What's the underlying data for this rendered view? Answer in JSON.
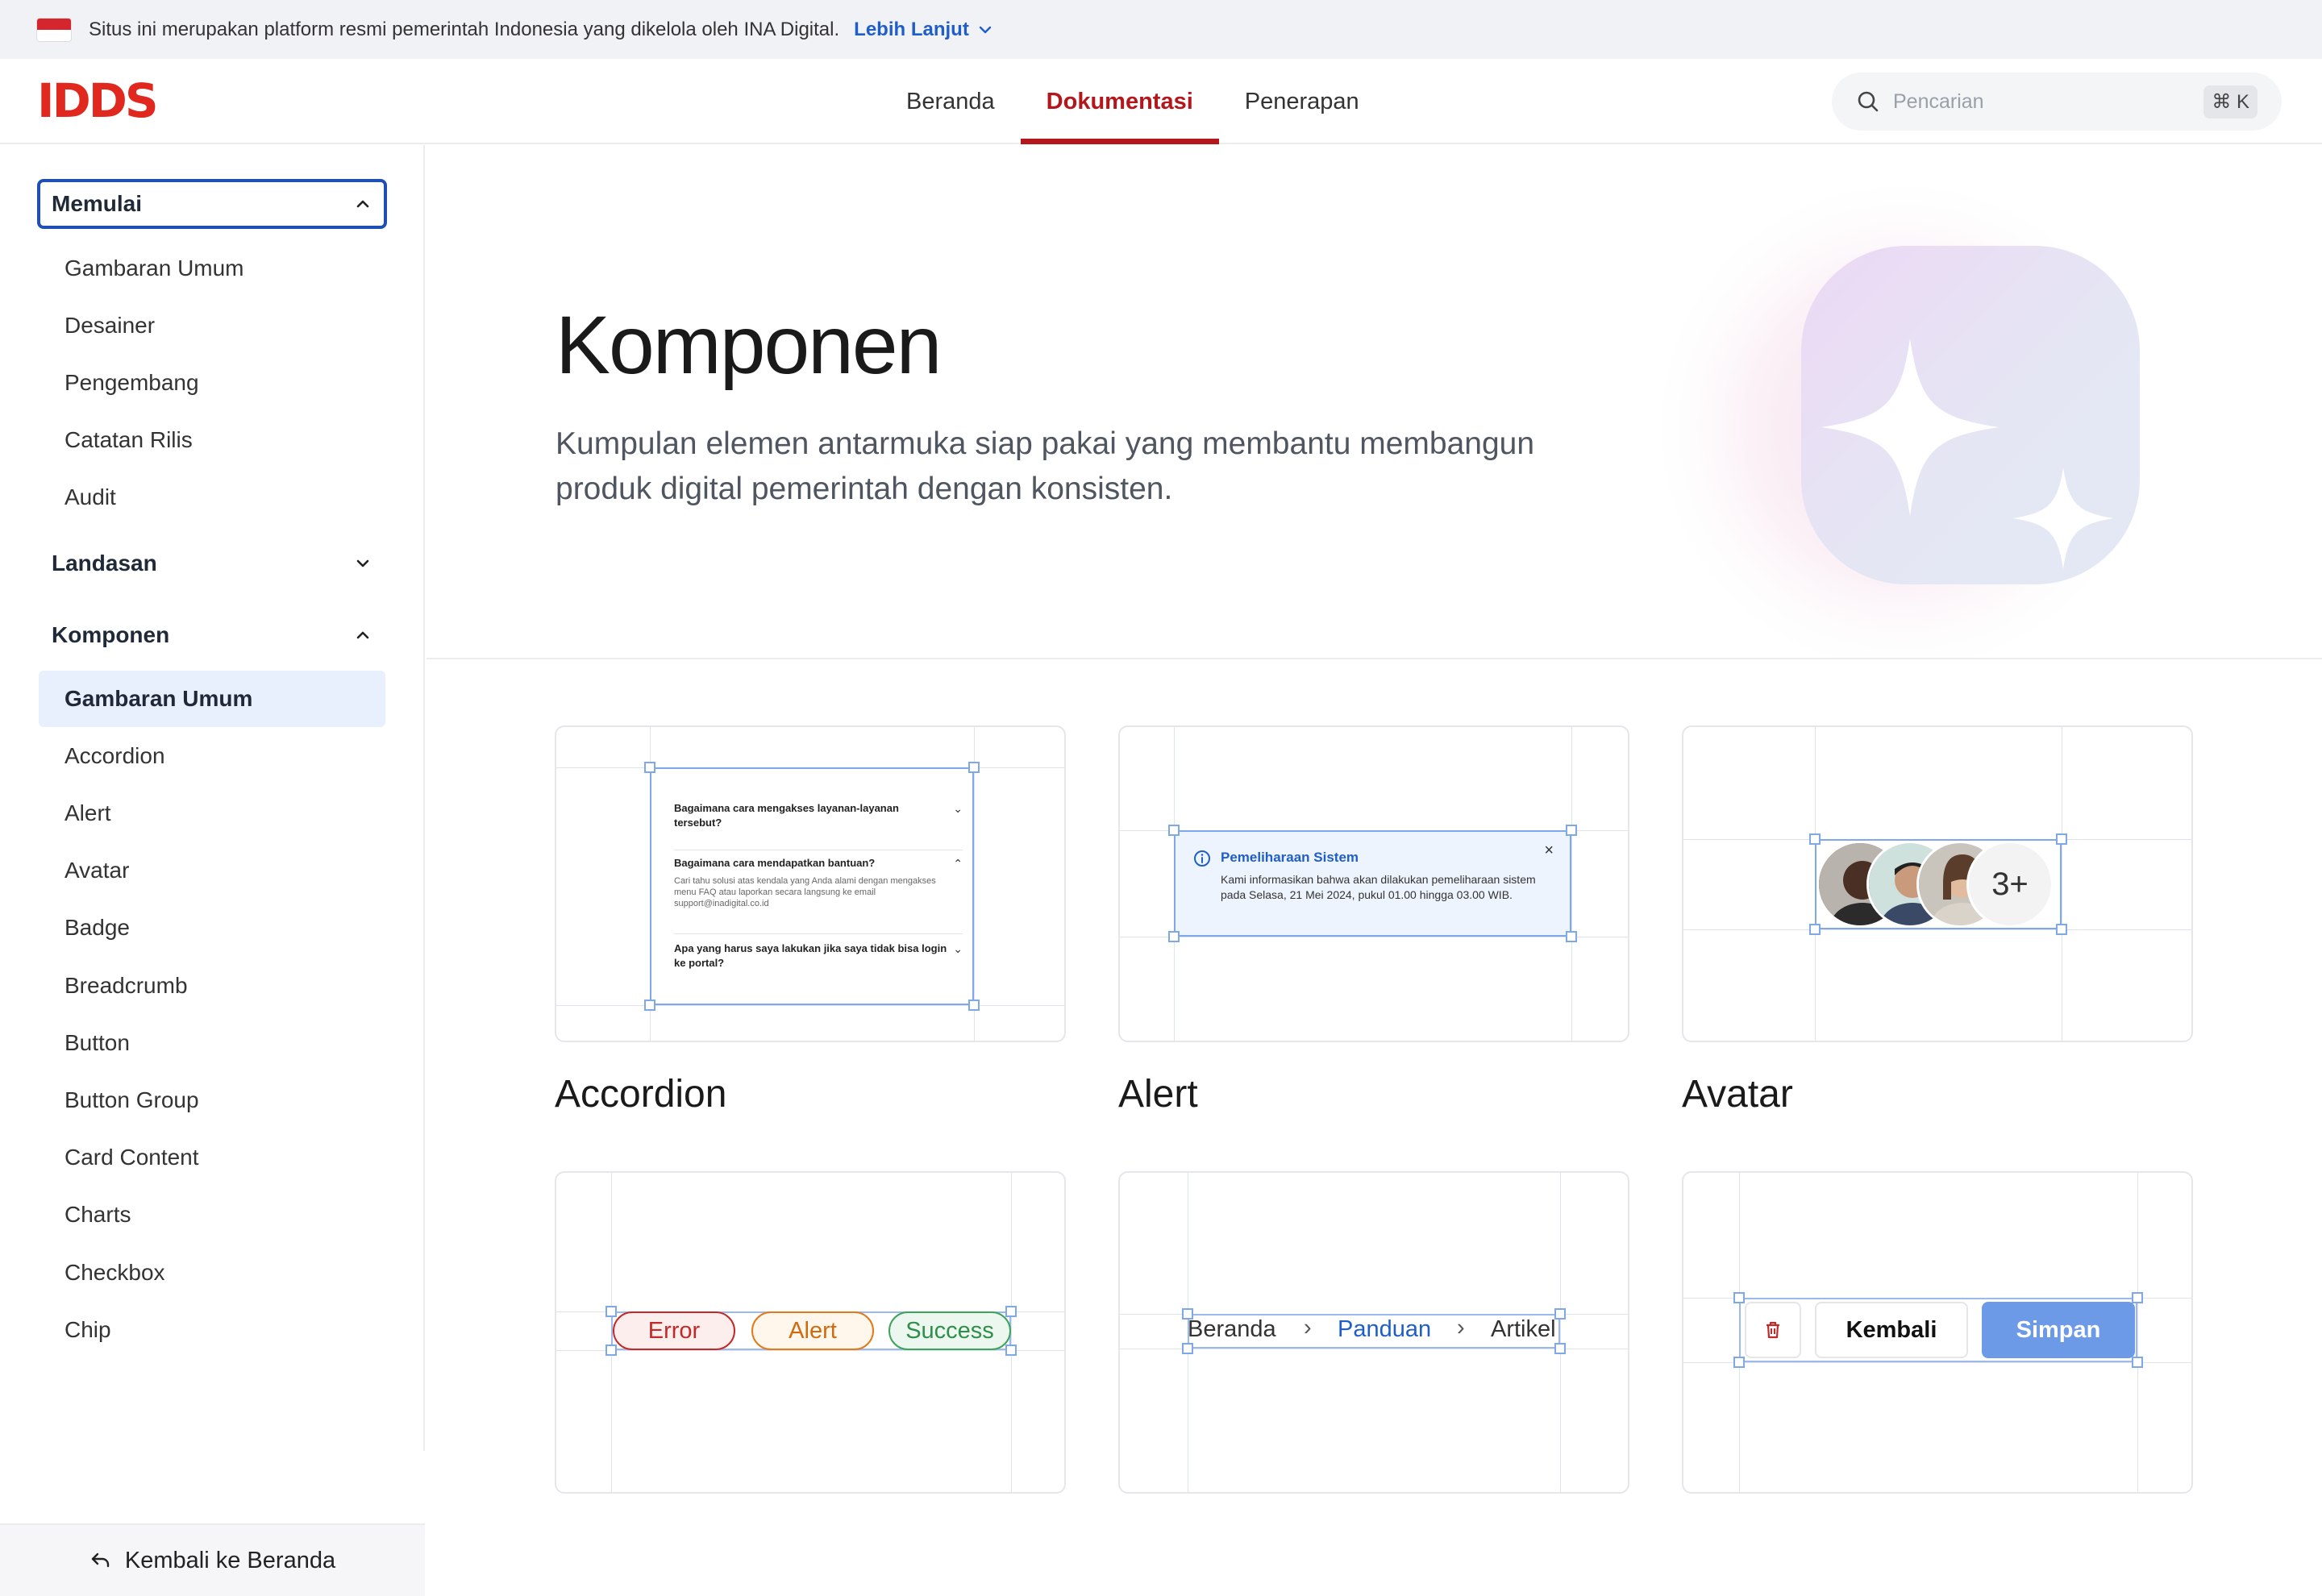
{
  "banner": {
    "text": "Situs ini merupakan platform resmi pemerintah Indonesia yang dikelola oleh INA Digital.",
    "link": "Lebih Lanjut"
  },
  "header": {
    "logo": "IDDS",
    "nav": [
      {
        "label": "Beranda",
        "active": false
      },
      {
        "label": "Dokumentasi",
        "active": true
      },
      {
        "label": "Penerapan",
        "active": false
      }
    ],
    "search": {
      "placeholder": "Pencarian",
      "shortcut": "⌘ K"
    }
  },
  "sidebar": {
    "sections": [
      {
        "title": "Memulai",
        "expanded": true,
        "items": [
          "Gambaran Umum",
          "Desainer",
          "Pengembang",
          "Catatan Rilis",
          "Audit"
        ]
      },
      {
        "title": "Landasan",
        "expanded": false,
        "items": []
      },
      {
        "title": "Komponen",
        "expanded": true,
        "items": [
          "Gambaran Umum",
          "Accordion",
          "Alert",
          "Avatar",
          "Badge",
          "Breadcrumb",
          "Button",
          "Button Group",
          "Card Content",
          "Charts",
          "Checkbox",
          "Chip"
        ],
        "active_item": "Gambaran Umum"
      }
    ],
    "back": "Kembali ke Beranda"
  },
  "hero": {
    "title": "Komponen",
    "description": "Kumpulan elemen antarmuka siap pakai yang membantu membangun produk digital pemerintah dengan konsisten."
  },
  "cards": [
    {
      "label": "Accordion"
    },
    {
      "label": "Alert"
    },
    {
      "label": "Avatar"
    }
  ],
  "previews": {
    "accordion": {
      "q1": "Bagaimana cara mengakses layanan-layanan tersebut?",
      "q2": "Bagaimana cara mendapatkan bantuan?",
      "a2": "Cari tahu solusi atas kendala yang Anda alami dengan mengakses menu FAQ atau laporkan secara langsung ke email support@inadigital.co.id",
      "q3": "Apa yang harus saya lakukan jika saya tidak bisa login ke portal?"
    },
    "alert": {
      "title": "Pemeliharaan Sistem",
      "body": "Kami informasikan bahwa akan dilakukan pemeliharaan sistem pada Selasa, 21 Mei 2024, pukul 01.00 hingga 03.00 WIB."
    },
    "avatar": {
      "more": "3+"
    },
    "badges": [
      "Error",
      "Alert",
      "Success"
    ],
    "breadcrumb": [
      "Beranda",
      "Panduan",
      "Artikel"
    ],
    "buttons": {
      "back": "Kembali",
      "save": "Simpan"
    }
  },
  "colors": {
    "brand_red": "#b3171b",
    "link_blue": "#1f5ec8",
    "focus_blue": "#1f4fb5",
    "active_bg": "#e8f0fd"
  }
}
